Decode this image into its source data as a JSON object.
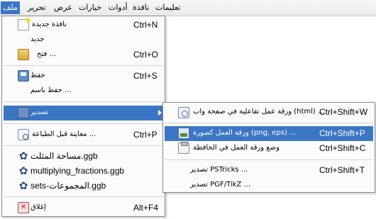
{
  "menubar": {
    "items": [
      "ملف",
      "تحرير",
      "عرض",
      "خيارات",
      "أدوات",
      "نافذة",
      "تعليمات"
    ],
    "active_index": 0
  },
  "file_menu": {
    "items": [
      {
        "label": "نافذة جديدة",
        "shortcut": "Ctrl+N",
        "icon": "new-window-icon"
      },
      {
        "label": "جديد",
        "shortcut": "",
        "icon": ""
      },
      {
        "label": "فتح ...",
        "shortcut": "Ctrl+O",
        "icon": "open-folder-icon"
      },
      {
        "label": "حفظ",
        "shortcut": "Ctrl+S",
        "icon": "save-icon"
      },
      {
        "label": "حفظ باسم ...",
        "shortcut": "",
        "icon": ""
      },
      {
        "label": "تصدير",
        "shortcut": "",
        "icon": "export-icon"
      },
      {
        "label": "معاينة قبل الطباعة ...",
        "shortcut": "Ctrl+P",
        "icon": "print-preview-icon"
      },
      {
        "label": "مساحة المثلث.ggb",
        "shortcut": "",
        "icon": "geogebra-file-icon"
      },
      {
        "label": "multiplying_fractions.ggb",
        "shortcut": "",
        "icon": "geogebra-file-icon"
      },
      {
        "label": "sets-المجموعات.ggb",
        "shortcut": "",
        "icon": "geogebra-file-icon"
      },
      {
        "label": "إغلاق",
        "shortcut": "Alt+F4",
        "icon": "close-icon"
      }
    ]
  },
  "export_menu": {
    "items": [
      {
        "label": "ورقة عمل تفاعلية في صفحة واب (html) ...",
        "shortcut": "Ctrl+Shift+W",
        "icon": "web-page-icon"
      },
      {
        "label": "ورقة العمل كصورة (png, eps) ...",
        "shortcut": "Ctrl+Shift+P",
        "icon": "image-icon"
      },
      {
        "label": "وضع ورقة العمل في الحافظة",
        "shortcut": "Ctrl+Shift+C",
        "icon": "clipboard-icon"
      },
      {
        "label": "تصدير PSTricks ...",
        "shortcut": "Ctrl+Shift+T",
        "icon": ""
      },
      {
        "label": "تصدير PGF/TikZ ...",
        "shortcut": "",
        "icon": ""
      }
    ]
  },
  "colors": {
    "highlight": "#3b76c5",
    "menu_background": "#fbfbfb"
  }
}
